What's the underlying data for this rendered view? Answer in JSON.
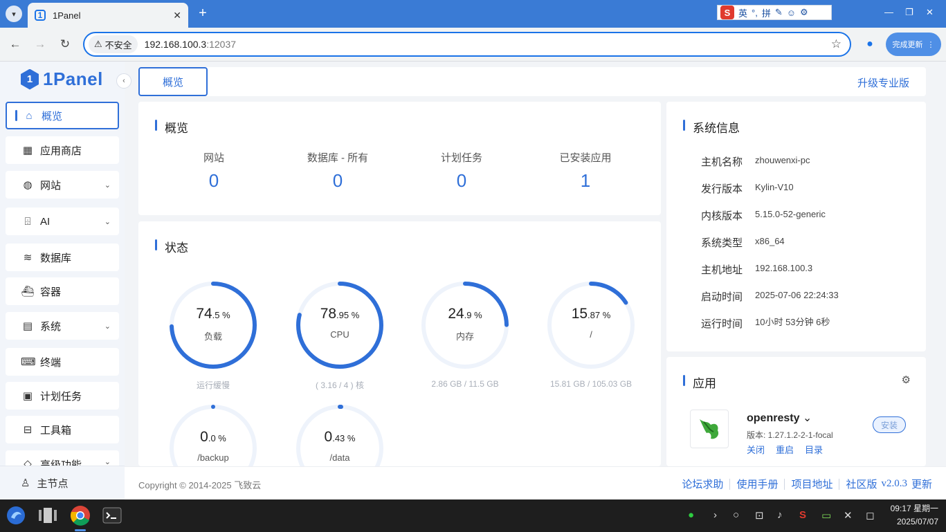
{
  "browser": {
    "tab_title": "1Panel",
    "security_label": "不安全",
    "url_host": "192.168.100.3",
    "url_port": ":12037",
    "update_label": "完成更新",
    "ime": {
      "logo": "S",
      "lang": "英",
      "punct": "°,",
      "mode": "拼"
    }
  },
  "sidebar": {
    "brand": "1Panel",
    "items": [
      {
        "label": "概览",
        "icon": "home-icon",
        "expandable": false,
        "active": true
      },
      {
        "label": "应用商店",
        "icon": "grid-icon",
        "expandable": false
      },
      {
        "label": "网站",
        "icon": "globe-icon",
        "expandable": true
      },
      {
        "label": "AI",
        "icon": "robot-icon",
        "expandable": true
      },
      {
        "label": "数据库",
        "icon": "layers-icon",
        "expandable": false
      },
      {
        "label": "容器",
        "icon": "docker-icon",
        "expandable": false
      },
      {
        "label": "系统",
        "icon": "server-icon",
        "expandable": true
      },
      {
        "label": "终端",
        "icon": "terminal-icon",
        "expandable": false
      },
      {
        "label": "计划任务",
        "icon": "calendar-icon",
        "expandable": false
      },
      {
        "label": "工具箱",
        "icon": "toolbox-icon",
        "expandable": false
      },
      {
        "label": "高级功能",
        "icon": "diamond-icon",
        "expandable": true
      }
    ],
    "footer_label": "主节点"
  },
  "header": {
    "tab_label": "概览",
    "upgrade_label": "升级专业版"
  },
  "overview": {
    "title": "概览",
    "items": [
      {
        "label": "网站",
        "value": "0"
      },
      {
        "label": "数据库 - 所有",
        "value": "0"
      },
      {
        "label": "计划任务",
        "value": "0"
      },
      {
        "label": "已安装应用",
        "value": "1"
      }
    ]
  },
  "status": {
    "title": "状态",
    "gauges": [
      {
        "int": "74",
        "dec": ".5",
        "unit": " %",
        "name": "负载",
        "sub": "运行缓慢",
        "percent": 74.5
      },
      {
        "int": "78",
        "dec": ".95",
        "unit": " %",
        "name": "CPU",
        "sub": "( 3.16 / 4 ) 核",
        "percent": 78.95
      },
      {
        "int": "24",
        "dec": ".9",
        "unit": " %",
        "name": "内存",
        "sub": "2.86 GB / 11.5 GB",
        "percent": 24.9
      },
      {
        "int": "15",
        "dec": ".87",
        "unit": " %",
        "name": "/",
        "sub": "15.81 GB / 105.03 GB",
        "percent": 15.87
      },
      {
        "int": "0",
        "dec": ".0",
        "unit": " %",
        "name": "/backup",
        "sub": "",
        "percent": 0.0
      },
      {
        "int": "0",
        "dec": ".43",
        "unit": " %",
        "name": "/data",
        "sub": "",
        "percent": 0.43
      }
    ]
  },
  "system_info": {
    "title": "系统信息",
    "rows": [
      {
        "key": "主机名称",
        "value": "zhouwenxi-pc"
      },
      {
        "key": "发行版本",
        "value": "Kylin-V10"
      },
      {
        "key": "内核版本",
        "value": "5.15.0-52-generic"
      },
      {
        "key": "系统类型",
        "value": "x86_64"
      },
      {
        "key": "主机地址",
        "value": "192.168.100.3"
      },
      {
        "key": "启动时间",
        "value": "2025-07-06 22:24:33"
      },
      {
        "key": "运行时间",
        "value": "10小时 53分钟 6秒"
      }
    ]
  },
  "apps": {
    "title": "应用",
    "items": [
      {
        "name": "openresty",
        "version": "版本: 1.27.1.2-2-1-focal",
        "status": "安装",
        "actions": [
          "关闭",
          "重启",
          "目录"
        ]
      }
    ]
  },
  "footer": {
    "copyright": "Copyright © 2014-2025 飞致云",
    "links": [
      "论坛求助",
      "使用手册",
      "项目地址",
      "社区版"
    ],
    "version": "v2.0.3",
    "update_label": "更新"
  },
  "taskbar": {
    "time": "09:17 星期一",
    "date": "2025/07/07"
  },
  "colors": {
    "accent": "#2f6fd8",
    "gauge_track": "#eef3fb"
  }
}
